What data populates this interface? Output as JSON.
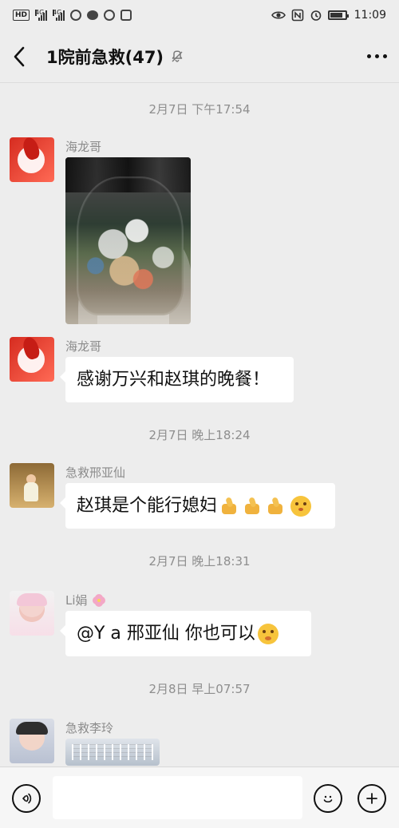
{
  "status_bar": {
    "hd": "HD",
    "network_1": "4G",
    "network_2": "4G",
    "time": "11:09",
    "battery_level": 0.86
  },
  "header": {
    "title": "1院前急救(47)"
  },
  "chat": {
    "dividers": [
      "2月7日 下午17:54",
      "2月7日 晚上18:24",
      "2月7日 晚上18:31",
      "2月8日 早上07:57"
    ],
    "messages": [
      {
        "sender": "海龙哥",
        "type": "image"
      },
      {
        "sender": "海龙哥",
        "text": "感谢万兴和赵琪的晚餐！"
      },
      {
        "sender": "急救邢亚仙",
        "text": "赵琪是个能行媳妇"
      },
      {
        "sender": "Li娟",
        "text": "@Y a 邢亚仙 你也可以"
      },
      {
        "sender": "急救李玲",
        "type": "image"
      }
    ]
  },
  "input_bar": {
    "message_value": "",
    "voice_icon": "voice-icon",
    "emoji_icon": "emoji-icon",
    "plus_icon": "plus-icon"
  }
}
